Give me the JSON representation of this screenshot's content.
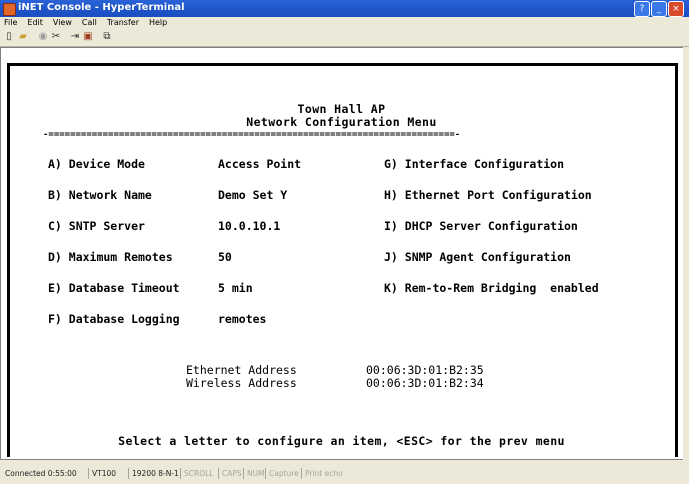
{
  "window": {
    "title": "iNET Console - HyperTerminal",
    "icon": "hyperterminal-phone-icon"
  },
  "menu": [
    "File",
    "Edit",
    "View",
    "Call",
    "Transfer",
    "Help"
  ],
  "toolbar": [
    "new-icon",
    "open-icon",
    "connect-icon",
    "disconnect-icon",
    "send-icon",
    "receive-icon",
    "properties-icon"
  ],
  "terminal": {
    "header1": "Town Hall AP",
    "header2": "Network Configuration Menu",
    "separator": "-===========================================================================-",
    "left": [
      {
        "key": "A) Device Mode",
        "value": "Access Point"
      },
      {
        "key": "B) Network Name",
        "value": "Demo Set Y"
      },
      {
        "key": "C) SNTP Server",
        "value": "10.0.10.1"
      },
      {
        "key": "D) Maximum Remotes",
        "value": "50"
      },
      {
        "key": "E) Database Timeout",
        "value": "5 min"
      },
      {
        "key": "F) Database Logging",
        "value": "remotes"
      }
    ],
    "right": [
      "G) Interface Configuration",
      "H) Ethernet Port Configuration",
      "I) DHCP Server Configuration",
      "J) SNMP Agent Configuration",
      "K) Rem-to-Rem Bridging  enabled"
    ],
    "ethernet_label": "Ethernet Address",
    "ethernet_value": "00:06:3D:01:B2:35",
    "wireless_label": "Wireless Address",
    "wireless_value": "00:06:3D:01:B2:34",
    "prompt": "Select a letter to configure an item, <ESC> for the prev menu"
  },
  "status": {
    "connected": "Connected 0:55:00",
    "emulation": "VT100",
    "settings": "19200 8-N-1",
    "scroll": "SCROLL",
    "caps": "CAPS",
    "num": "NUM",
    "capture": "Capture",
    "print": "Print echo"
  },
  "colors": {
    "titlebar": "#1f55c9",
    "close_button": "#d84b2a",
    "terminal_bg": "#ffffff"
  }
}
